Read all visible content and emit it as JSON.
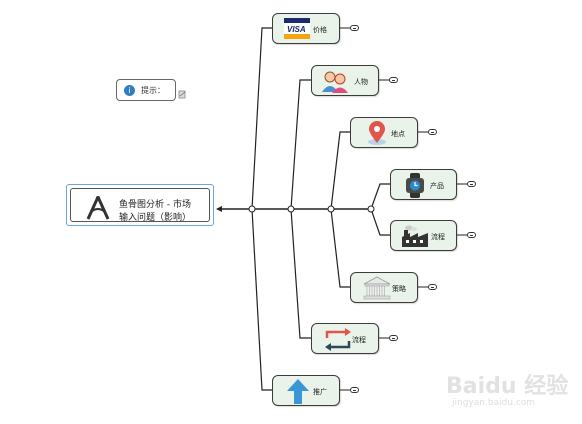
{
  "central_topic": {
    "line1": "鱼骨图分析 - 市场",
    "line2": "输入问题（影响）"
  },
  "hint": {
    "label": "提示："
  },
  "branches": [
    {
      "label": "价格",
      "icon": "visa-card-icon"
    },
    {
      "label": "人物",
      "icon": "people-icon"
    },
    {
      "label": "地点",
      "icon": "map-pin-icon"
    },
    {
      "label": "产品",
      "icon": "watch-icon"
    },
    {
      "label": "流程",
      "icon": "factory-icon"
    },
    {
      "label": "策略",
      "icon": "bank-building-icon"
    },
    {
      "label": "流程",
      "icon": "cycle-arrows-icon"
    },
    {
      "label": "推广",
      "icon": "up-arrow-icon"
    }
  ],
  "watermark": {
    "brand": "Baidu 经验",
    "url": "jingyan.baidu.com"
  },
  "colors": {
    "topic_fill": "#e9f3ea",
    "central_border": "#6aa8e3",
    "line": "#222222"
  }
}
